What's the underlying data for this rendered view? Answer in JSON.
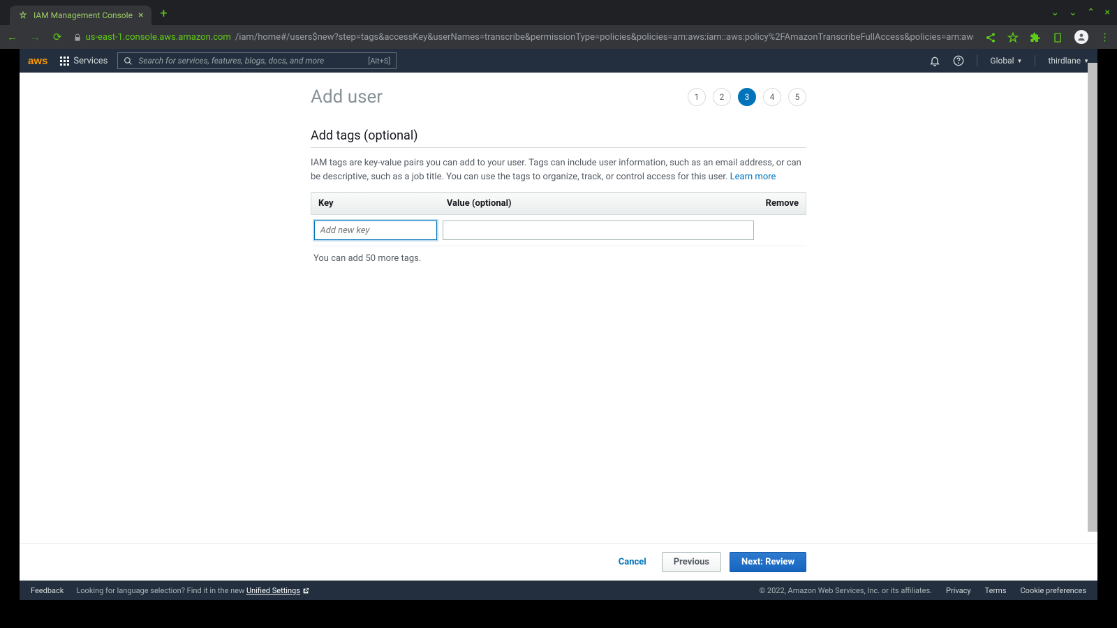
{
  "browser": {
    "tab_title": "IAM Management Console",
    "url_domain": "us-east-1.console.aws.amazon.com",
    "url_path": "/iam/home#/users$new?step=tags&accessKey&userNames=transcribe&permissionType=policies&policies=arn:aws:iam::aws:policy%2FAmazonTranscribeFullAccess&policies=arn:aws:ia..."
  },
  "aws_nav": {
    "services_label": "Services",
    "search_placeholder": "Search for services, features, blogs, docs, and more",
    "search_shortcut": "[Alt+S]",
    "region": "Global",
    "account": "thirdlane"
  },
  "page": {
    "title": "Add user",
    "steps": [
      "1",
      "2",
      "3",
      "4",
      "5"
    ],
    "active_step": 3,
    "section_title": "Add tags (optional)",
    "section_desc": "IAM tags are key-value pairs you can add to your user. Tags can include user information, such as an email address, or can be descriptive, such as a job title. You can use the tags to organize, track, or control access for this user. ",
    "learn_more": "Learn more",
    "table": {
      "col_key": "Key",
      "col_value": "Value (optional)",
      "col_remove": "Remove",
      "key_placeholder": "Add new key"
    },
    "tags_hint": "You can add 50 more tags.",
    "buttons": {
      "cancel": "Cancel",
      "previous": "Previous",
      "next": "Next: Review"
    }
  },
  "footer": {
    "feedback": "Feedback",
    "lang_hint": "Looking for language selection? Find it in the new ",
    "lang_link": "Unified Settings",
    "copyright": "© 2022, Amazon Web Services, Inc. or its affiliates.",
    "links": [
      "Privacy",
      "Terms",
      "Cookie preferences"
    ]
  }
}
